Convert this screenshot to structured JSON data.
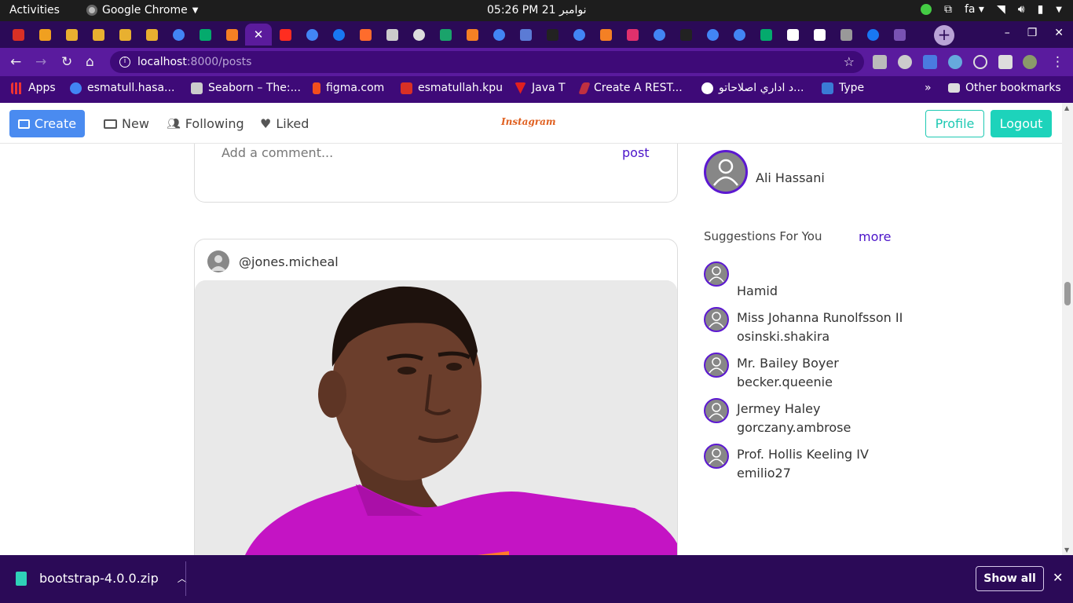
{
  "system_bar": {
    "activities": "Activities",
    "app_name": "Google Chrome",
    "clock": "05:26 PM  21 نوامبر",
    "language": "fa"
  },
  "browser": {
    "tabs": [
      {
        "icon": "gmail-icon",
        "color": "#d93025"
      },
      {
        "icon": "pma-icon",
        "color": "#f0a020"
      },
      {
        "icon": "xampp-icon",
        "color": "#e8b030"
      },
      {
        "icon": "xampp-icon",
        "color": "#e8b030"
      },
      {
        "icon": "xampp-icon",
        "color": "#e8b030"
      },
      {
        "icon": "xampp-icon",
        "color": "#e8b030"
      },
      {
        "icon": "google-icon",
        "color": "#4285f4"
      },
      {
        "icon": "w3schools-icon",
        "color": "#04aa6d"
      },
      {
        "icon": "stackoverflow-icon",
        "color": "#f48024"
      },
      {
        "icon": "close-icon",
        "color": "#ffffff",
        "active": true
      },
      {
        "icon": "laravel-icon",
        "color": "#ff2d20"
      },
      {
        "icon": "google-icon",
        "color": "#4285f4"
      },
      {
        "icon": "facebook-icon",
        "color": "#1877f2"
      },
      {
        "icon": "cpanel-icon",
        "color": "#ff6c2c"
      },
      {
        "icon": "page-icon",
        "color": "#cccccc"
      },
      {
        "icon": "globe-icon",
        "color": "#dddddd"
      },
      {
        "icon": "book-icon",
        "color": "#1aa36b"
      },
      {
        "icon": "stackoverflow-icon",
        "color": "#f48024"
      },
      {
        "icon": "google-icon",
        "color": "#4285f4"
      },
      {
        "icon": "code-icon",
        "color": "#5b7bd5"
      },
      {
        "icon": "dark-icon",
        "color": "#222222"
      },
      {
        "icon": "google-icon",
        "color": "#4285f4"
      },
      {
        "icon": "stackoverflow-icon",
        "color": "#f48024"
      },
      {
        "icon": "instagram-icon",
        "color": "#e1306c"
      },
      {
        "icon": "google-icon",
        "color": "#4285f4"
      },
      {
        "icon": "dark-icon",
        "color": "#222222"
      },
      {
        "icon": "google-icon",
        "color": "#4285f4"
      },
      {
        "icon": "google-icon",
        "color": "#4285f4"
      },
      {
        "icon": "w3schools-icon",
        "color": "#04aa6d"
      },
      {
        "icon": "codepen-icon",
        "color": "#ffffff"
      },
      {
        "icon": "github-icon",
        "color": "#ffffff"
      },
      {
        "icon": "terminal-icon",
        "color": "#999999"
      },
      {
        "icon": "facebook-icon",
        "color": "#1877f2"
      },
      {
        "icon": "bootstrap-icon",
        "color": "#7952b3"
      }
    ],
    "url_host": "localhost",
    "url_path": ":8000/posts",
    "bookmarks": {
      "apps": "Apps",
      "items": [
        {
          "label": "esmatull.hasa...",
          "icon": "google-icon",
          "color": "#4285f4"
        },
        {
          "label": "Seaborn – The:...",
          "icon": "seaborn-icon",
          "color": "#cccccc"
        },
        {
          "label": "figma.com",
          "icon": "figma-icon",
          "color": "#f24e1e"
        },
        {
          "label": "esmatullah.kpu",
          "icon": "gmail-icon",
          "color": "#d93025"
        },
        {
          "label": "Java T",
          "icon": "javat-icon",
          "color": "#e02020"
        },
        {
          "label": "Create A REST...",
          "icon": "rest-icon",
          "color": "#c03040"
        },
        {
          "label": "د اداري اصلاحاتو...",
          "icon": "globe-icon",
          "color": "#ffffff"
        },
        {
          "label": "Type",
          "icon": "type-icon",
          "color": "#3a7bd5"
        }
      ],
      "overflow": "»",
      "other": "Other bookmarks"
    }
  },
  "app": {
    "nav": {
      "create": "Create",
      "new": "New",
      "following": "Following",
      "liked": "Liked",
      "logo": "Instagram",
      "profile": "Profile",
      "logout": "Logout"
    },
    "comment_box": {
      "placeholder": "Add a comment...",
      "post": "post"
    },
    "post": {
      "username": "@jones.micheal"
    },
    "sidebar": {
      "user_name": "Ali Hassani",
      "suggestions_title": "Suggestions For You",
      "more": "more",
      "suggestions": [
        {
          "name": "",
          "username": "Hamid"
        },
        {
          "name": "Miss Johanna Runolfsson II",
          "username": "osinski.shakira"
        },
        {
          "name": "Mr. Bailey Boyer",
          "username": "becker.queenie"
        },
        {
          "name": "Jermey Haley",
          "username": "gorczany.ambrose"
        },
        {
          "name": "Prof. Hollis Keeling IV",
          "username": "emilio27"
        }
      ]
    }
  },
  "downloads": {
    "file": "bootstrap-4.0.0.zip",
    "show_all": "Show all"
  },
  "colors": {
    "accent": "#5c18d1",
    "create_button": "#4a8bf0",
    "teal": "#1dd3bb",
    "shirt": "#c414c4"
  }
}
